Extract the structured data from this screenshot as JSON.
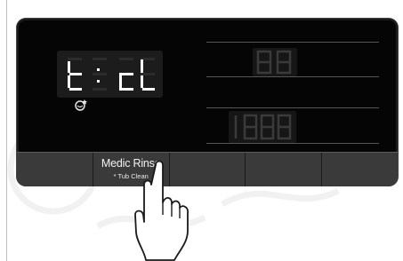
{
  "display": {
    "main_code": "t:cL",
    "upper_digits": "88",
    "lower_digits": "1888"
  },
  "buttons": [
    {
      "label": "Medic Rinse",
      "sub": "* Tub Clean"
    },
    {
      "label": "",
      "sub": ""
    },
    {
      "label": "",
      "sub": ""
    },
    {
      "label": "",
      "sub": ""
    },
    {
      "label": "",
      "sub": ""
    }
  ],
  "colors": {
    "segment_lit": "#ffffff",
    "segment_dim": "#2c2c2c",
    "panel": "#050505",
    "button_bar": "#3a3a3a"
  },
  "icons": [
    "tub-clean-icon",
    "pointing-hand-icon"
  ]
}
